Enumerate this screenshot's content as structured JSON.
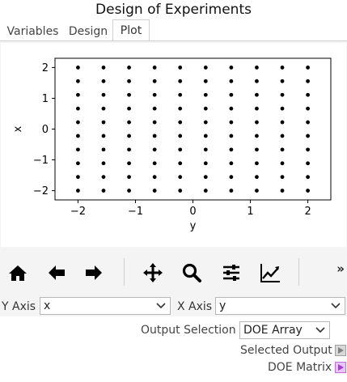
{
  "window": {
    "title": "Design of Experiments"
  },
  "tabs": [
    {
      "label": "Variables",
      "active": false
    },
    {
      "label": "Design",
      "active": false
    },
    {
      "label": "Plot",
      "active": true
    }
  ],
  "toolbar": {
    "buttons": [
      "home-icon",
      "back-icon",
      "forward-icon",
      "pan-icon",
      "zoom-icon",
      "configure-subplots-icon",
      "edit-axis-icon"
    ],
    "more_label": "»"
  },
  "axis_controls": {
    "y_axis_label": "Y Axis",
    "y_axis_value": "x",
    "x_axis_label": "X Axis",
    "x_axis_value": "y"
  },
  "output": {
    "selection_label": "Output Selection",
    "selection_value": "DOE Array",
    "selected_output_label": "Selected Output",
    "doe_matrix_label": "DOE Matrix"
  },
  "colors": {
    "points": "#000000",
    "flag_inactive": "#a0a0a0",
    "flag_active": "#c070e0"
  },
  "chart_data": {
    "type": "scatter",
    "title": "",
    "xlabel": "y",
    "ylabel": "x",
    "xlim": [
      -2.4,
      2.4
    ],
    "ylim": [
      -2.3,
      2.3
    ],
    "x_ticks": [
      -2,
      -1,
      0,
      1,
      2
    ],
    "x_tick_labels": [
      "−2",
      "−1",
      "0",
      "1",
      "2"
    ],
    "y_ticks": [
      -2,
      -1,
      0,
      1,
      2
    ],
    "y_tick_labels": [
      "−2",
      "−1",
      "0",
      "1",
      "2"
    ],
    "grid": false,
    "x_levels": [
      -2,
      -1.5556,
      -1.1111,
      -0.6667,
      -0.2222,
      0.2222,
      0.6667,
      1.1111,
      1.5556,
      2
    ],
    "y_levels": [
      -2,
      -1.5556,
      -1.1111,
      -0.6667,
      -0.2222,
      0.2222,
      0.6667,
      1.1111,
      1.5556,
      2
    ],
    "note_points_are_full_factorial_of_levels": true
  }
}
